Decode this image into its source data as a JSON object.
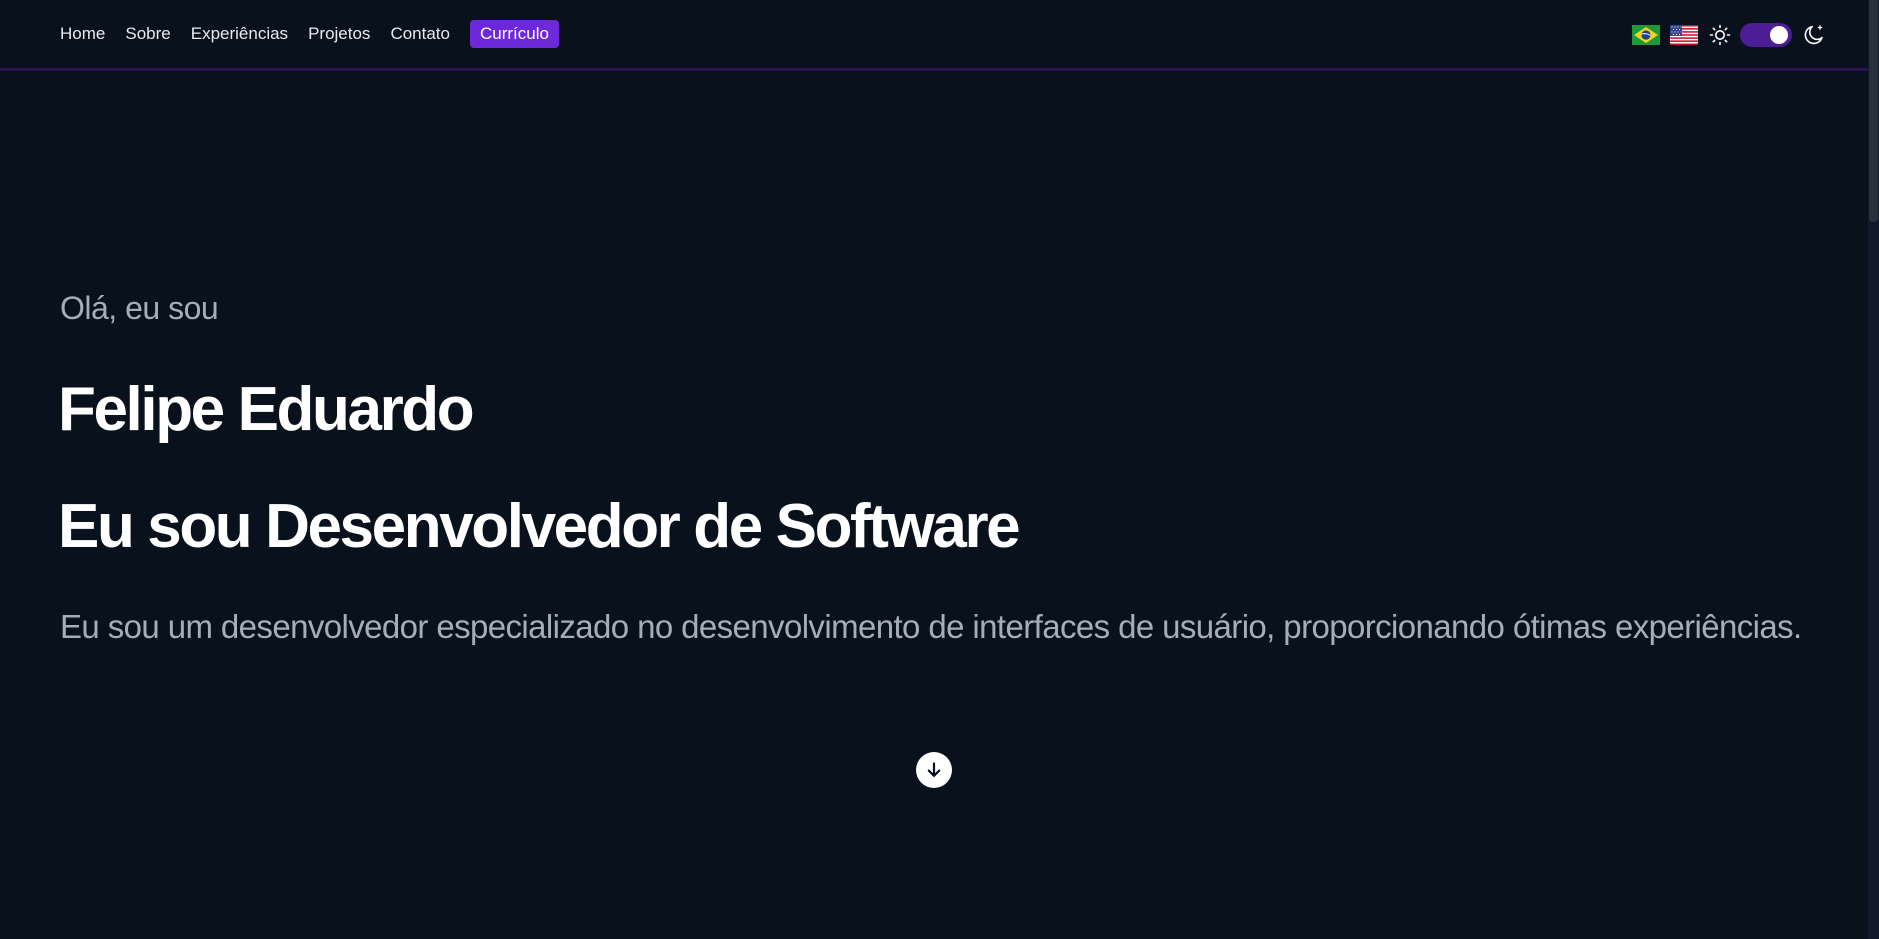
{
  "nav": {
    "links": [
      "Home",
      "Sobre",
      "Experiências",
      "Projetos",
      "Contato"
    ],
    "cta_label": "Currículo"
  },
  "tools": {
    "flags": [
      "brazil-flag-icon",
      "usa-flag-icon"
    ],
    "theme_toggle": {
      "light_icon": "sun-icon",
      "dark_icon": "moon-icon",
      "state": "dark"
    }
  },
  "hero": {
    "greeting": "Olá, eu sou",
    "name": "Felipe Eduardo",
    "role": "Eu sou Desenvolvedor de Software",
    "description": "Eu sou um desenvolvedor especializado no desenvolvimento de interfaces de usuário, proporcionando ótimas experiências.",
    "scroll_icon": "arrow-down-icon"
  },
  "colors": {
    "background": "#09111d",
    "accent": "#6d28d9",
    "toggle": "#4c1d95",
    "muted_text": "#a6adb8"
  }
}
